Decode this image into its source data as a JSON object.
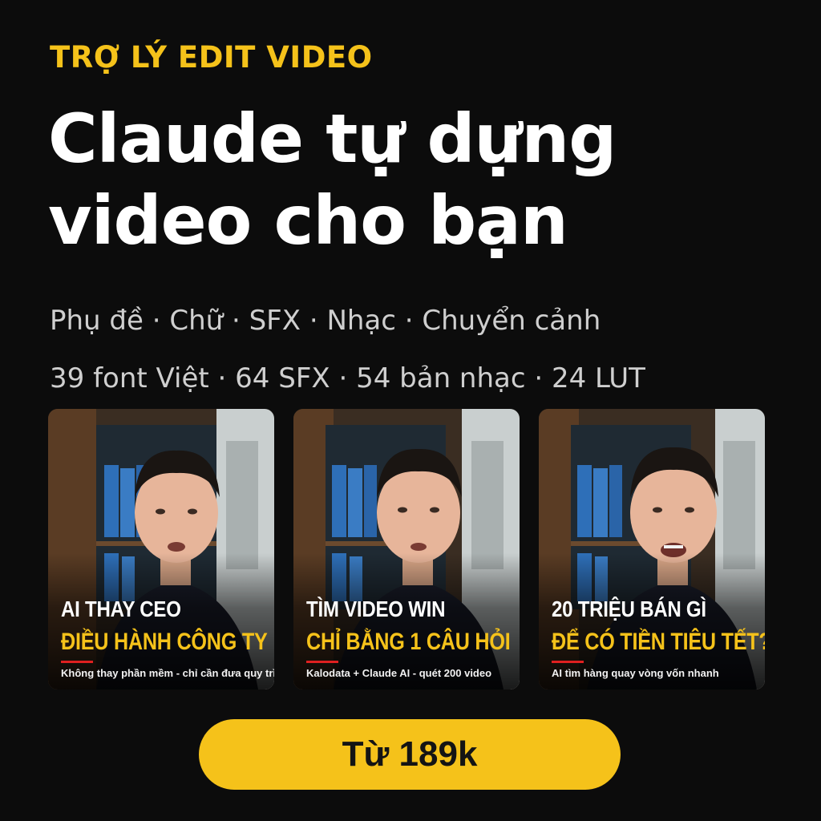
{
  "eyebrow": "TRỢ LÝ EDIT VIDEO",
  "headline": {
    "line1": "Claude tự dựng",
    "line2": "video cho bạn"
  },
  "features": {
    "line1": "Phụ đề · Chữ · SFX · Nhạc · Chuyển cảnh",
    "line2": "39 font Việt · 64 SFX · 54 bản nhạc · 24 LUT"
  },
  "cards": [
    {
      "title_line1": "AI THAY CEO",
      "title_line2": "ĐIỀU HÀNH CÔNG TY",
      "caption": "Không thay phần mềm - chỉ cần đưa quy trình"
    },
    {
      "title_line1": "TÌM VIDEO WIN",
      "title_line2": "CHỈ BẰNG 1 CÂU HỎI",
      "caption": "Kalodata + Claude AI - quét 200 video"
    },
    {
      "title_line1": "20 TRIỆU BÁN GÌ",
      "title_line2": "ĐỂ CÓ TIỀN TIÊU TẾT?",
      "caption": "AI tìm hàng quay vòng vốn nhanh"
    }
  ],
  "cta": {
    "label": "Từ 189k"
  },
  "colors": {
    "background": "#0c0c0c",
    "accent": "#f5c21a",
    "text": "#ffffff",
    "subtext": "#cfcfcf",
    "underline": "#e02020"
  }
}
